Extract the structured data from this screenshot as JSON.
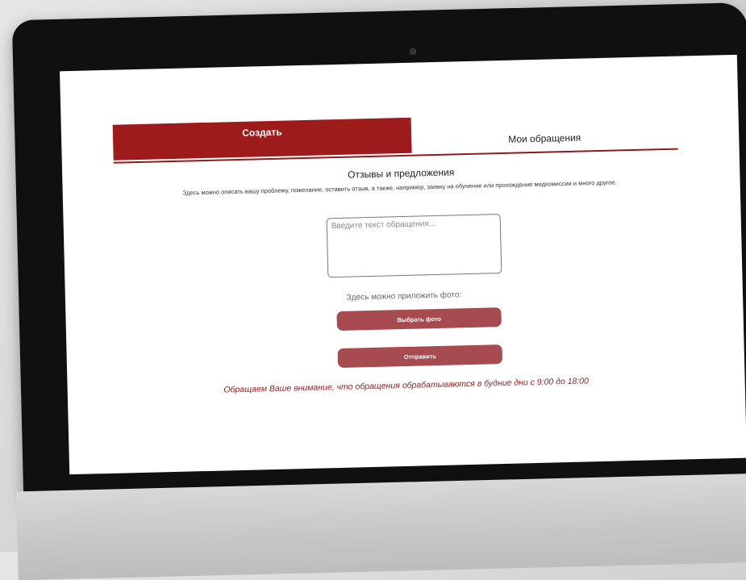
{
  "tabs": {
    "create": "Создать",
    "my_requests": "Мои обращения"
  },
  "form": {
    "title": "Отзывы и предложения",
    "description": "Здесь можно описать вашу проблему, пожелание, оставить отзыв, а также, например, заявку на обучение или прохождение медкомиссии и много другое.",
    "text_placeholder": "Введите текст обращения...",
    "photo_label": "Здесь можно приложить фото:",
    "choose_photo_button": "Выбрать фото",
    "submit_button": "Отправить",
    "notice": "Обращаем Ваше внимание, что обращения обрабатываются в будние дни с 9:00 до 18:00"
  },
  "colors": {
    "accent": "#9d1b1b",
    "button": "#a84b50"
  }
}
